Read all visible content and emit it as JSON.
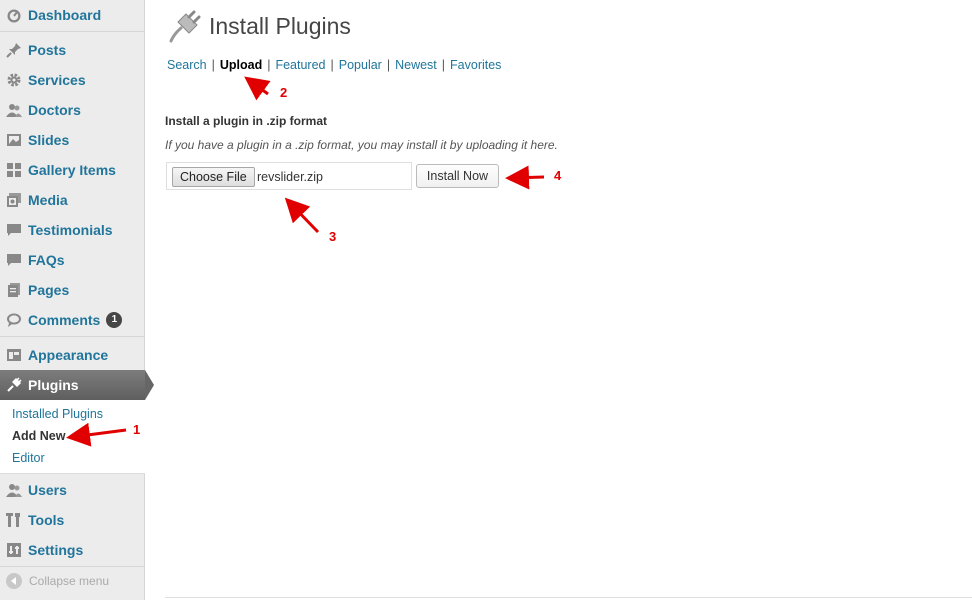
{
  "sidebar": {
    "items": [
      {
        "label": "Dashboard",
        "icon": "dashboard-icon"
      },
      {
        "label": "Posts",
        "icon": "pin-icon"
      },
      {
        "label": "Services",
        "icon": "gear-icon"
      },
      {
        "label": "Doctors",
        "icon": "users-icon"
      },
      {
        "label": "Slides",
        "icon": "image-icon"
      },
      {
        "label": "Gallery Items",
        "icon": "grid-icon"
      },
      {
        "label": "Media",
        "icon": "media-icon"
      },
      {
        "label": "Testimonials",
        "icon": "comment-icon"
      },
      {
        "label": "FAQs",
        "icon": "comment-icon"
      },
      {
        "label": "Pages",
        "icon": "pages-icon"
      },
      {
        "label": "Comments",
        "icon": "speech-bubble-icon",
        "badge": "1"
      },
      {
        "label": "Appearance",
        "icon": "appearance-icon"
      },
      {
        "label": "Plugins",
        "icon": "plug-icon"
      },
      {
        "label": "Users",
        "icon": "users-icon"
      },
      {
        "label": "Tools",
        "icon": "tools-icon"
      },
      {
        "label": "Settings",
        "icon": "settings-icon"
      }
    ],
    "submenu": [
      {
        "label": "Installed Plugins"
      },
      {
        "label": "Add New"
      },
      {
        "label": "Editor"
      }
    ],
    "collapse_label": "Collapse menu"
  },
  "main": {
    "title": "Install Plugins",
    "tabs": [
      {
        "label": "Search"
      },
      {
        "label": "Upload"
      },
      {
        "label": "Featured"
      },
      {
        "label": "Popular"
      },
      {
        "label": "Newest"
      },
      {
        "label": "Favorites"
      }
    ],
    "tab_separator": "|",
    "heading": "Install a plugin in .zip format",
    "description": "If you have a plugin in a .zip format, you may install it by uploading it here.",
    "choose_file_label": "Choose File",
    "file_name": "revslider.zip",
    "install_label": "Install Now"
  },
  "annotations": [
    "1",
    "2",
    "3",
    "4"
  ],
  "colors": {
    "link": "#21759b",
    "sidebar_bg": "#ececec",
    "active_menu": "#6d6d6d",
    "annotation": "#e00000"
  }
}
